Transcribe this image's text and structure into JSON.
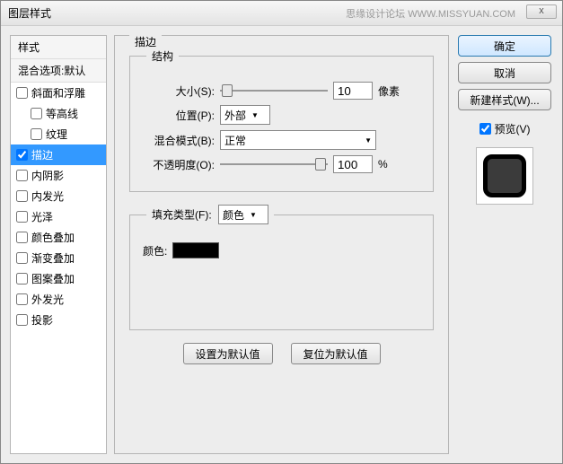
{
  "window": {
    "title": "图层样式",
    "brand": "思缘设计论坛 WWW.MISSYUAN.COM",
    "close_tooltip": "x"
  },
  "left": {
    "header_styles": "样式",
    "header_blend": "混合选项:默认",
    "items": [
      {
        "label": "斜面和浮雕",
        "checked": false,
        "selected": false,
        "sub": false
      },
      {
        "label": "等高线",
        "checked": false,
        "selected": false,
        "sub": true
      },
      {
        "label": "纹理",
        "checked": false,
        "selected": false,
        "sub": true
      },
      {
        "label": "描边",
        "checked": true,
        "selected": true,
        "sub": false
      },
      {
        "label": "内阴影",
        "checked": false,
        "selected": false,
        "sub": false
      },
      {
        "label": "内发光",
        "checked": false,
        "selected": false,
        "sub": false
      },
      {
        "label": "光泽",
        "checked": false,
        "selected": false,
        "sub": false
      },
      {
        "label": "颜色叠加",
        "checked": false,
        "selected": false,
        "sub": false
      },
      {
        "label": "渐变叠加",
        "checked": false,
        "selected": false,
        "sub": false
      },
      {
        "label": "图案叠加",
        "checked": false,
        "selected": false,
        "sub": false
      },
      {
        "label": "外发光",
        "checked": false,
        "selected": false,
        "sub": false
      },
      {
        "label": "投影",
        "checked": false,
        "selected": false,
        "sub": false
      }
    ]
  },
  "center": {
    "panel_title": "描边",
    "group_structure": "结构",
    "size_label": "大小(S):",
    "size_value": "10",
    "size_unit": "像素",
    "position_label": "位置(P):",
    "position_value": "外部",
    "blend_label": "混合模式(B):",
    "blend_value": "正常",
    "opacity_label": "不透明度(O):",
    "opacity_value": "100",
    "opacity_unit": "%",
    "group_fill": "填充类型(F):",
    "fill_type_value": "颜色",
    "color_label": "颜色:",
    "color_hex": "#000000",
    "btn_default": "设置为默认值",
    "btn_reset": "复位为默认值"
  },
  "right": {
    "ok": "确定",
    "cancel": "取消",
    "newstyle": "新建样式(W)...",
    "preview_label": "预览(V)",
    "preview_checked": true
  }
}
